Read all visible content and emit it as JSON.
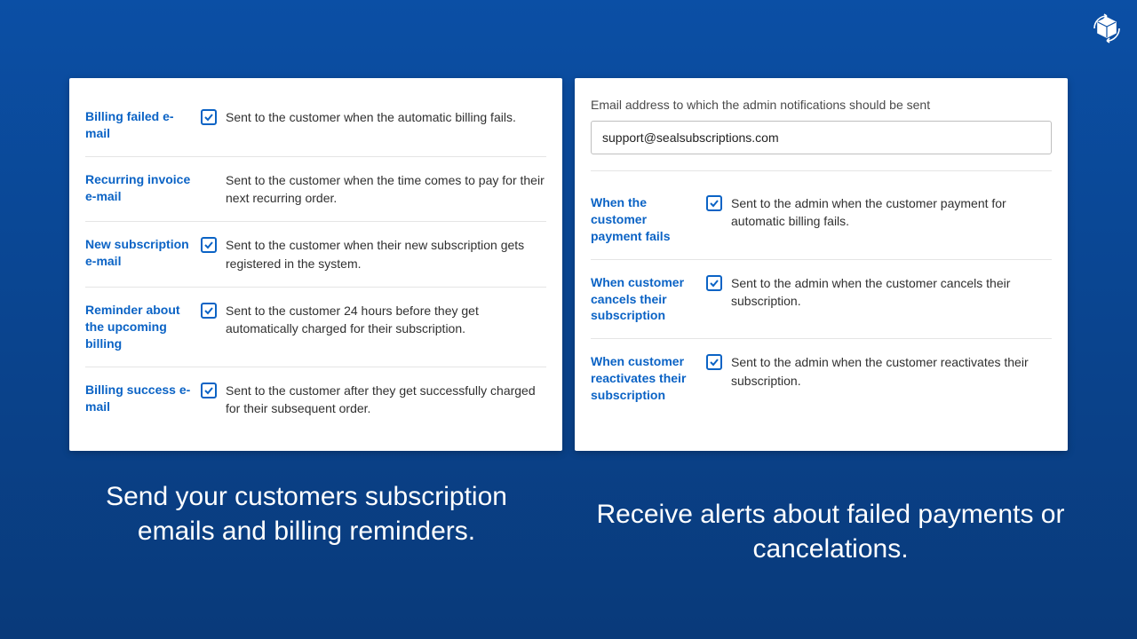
{
  "corner_icon": "refresh-box-icon",
  "left_panel": {
    "rows": [
      {
        "label": "Billing failed e-mail",
        "checked": true,
        "desc": "Sent to the customer when the automatic billing fails."
      },
      {
        "label": "Recurring invoice e-mail",
        "checked": false,
        "desc": "Sent to the customer when the time comes to pay for their next recurring order."
      },
      {
        "label": "New subscription e-mail",
        "checked": true,
        "desc": "Sent to the customer when their new subscription gets registered in the system."
      },
      {
        "label": "Reminder about the upcoming billing",
        "checked": true,
        "desc": "Sent to the customer 24 hours before they get automatically charged for their subscription."
      },
      {
        "label": "Billing success e-mail",
        "checked": true,
        "desc": "Sent to the customer after they get successfully charged for their subsequent order."
      }
    ]
  },
  "right_panel": {
    "email_label": "Email address to which the admin notifications should be sent",
    "email_value": "support@sealsubscriptions.com",
    "rows": [
      {
        "label": "When the customer payment fails",
        "checked": true,
        "desc": "Sent to the admin when the customer payment for automatic billing fails."
      },
      {
        "label": "When customer cancels their subscription",
        "checked": true,
        "desc": "Sent to the admin when the customer cancels their subscription."
      },
      {
        "label": "When customer reactivates their subscription",
        "checked": true,
        "desc": "Sent to the admin when the customer reactivates their subscription."
      }
    ]
  },
  "captions": {
    "left": "Send your customers subscription emails and billing reminders.",
    "right": "Receive alerts about failed payments or cancelations."
  }
}
